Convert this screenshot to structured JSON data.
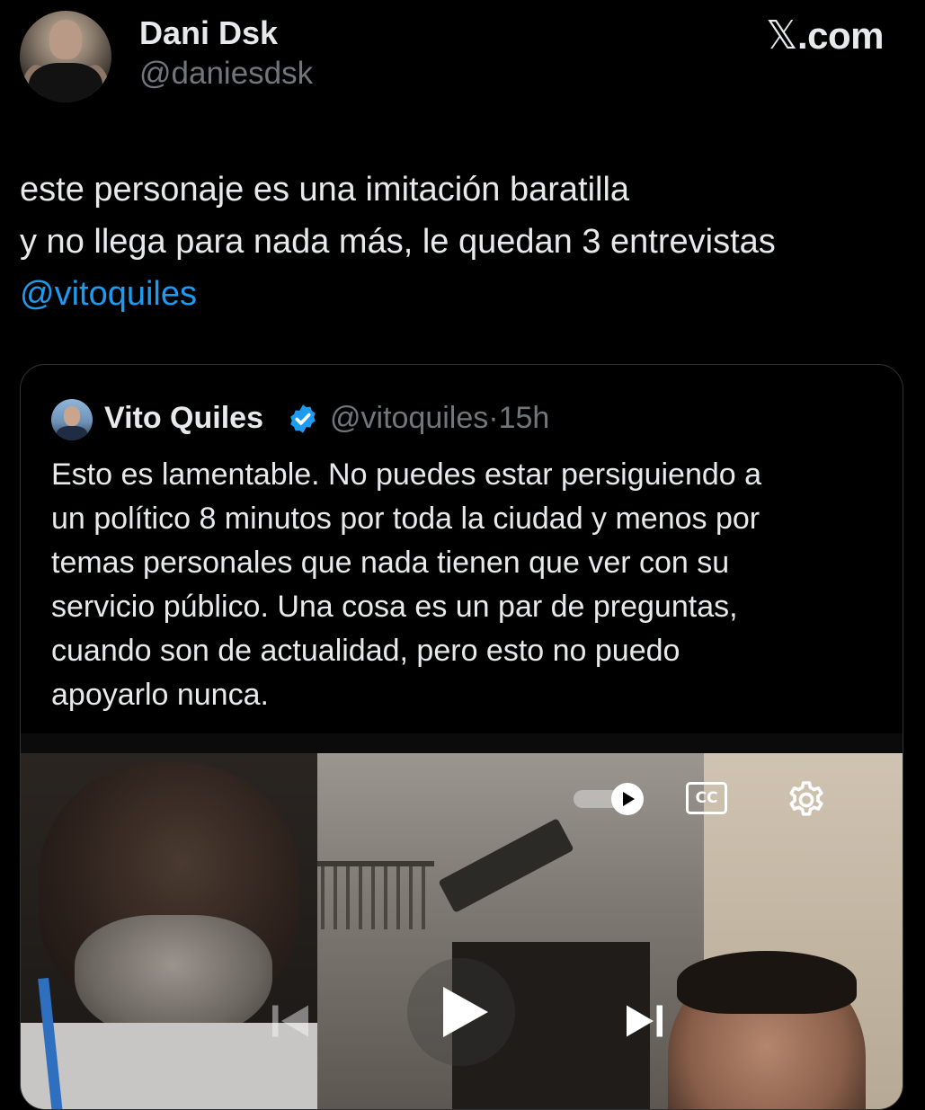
{
  "author": {
    "display_name": "Dani Dsk",
    "handle": "@daniesdsk"
  },
  "site": {
    "logo_mark": "𝕏",
    "logo_text": ".com"
  },
  "tweet": {
    "lines": [
      "este personaje es una imitación baratilla",
      "y no llega para nada más, le quedan 3 entrevistas"
    ],
    "mention": "@vitoquiles"
  },
  "quoted_tweet": {
    "display_name": "Vito Quiles",
    "verified": true,
    "handle": "@vitoquiles",
    "separator": "·",
    "time": "15h",
    "lines": [
      "Esto es lamentable. No puedes estar  persiguiendo a",
      "un político 8 minutos por toda la ciudad y menos por",
      "temas personales que nada tienen que ver con su",
      "servicio público. Una cosa es un par de preguntas,",
      "cuando son de actualidad, pero esto no puedo",
      "apoyarlo nunca."
    ]
  },
  "video_controls": {
    "cc_label": "CC",
    "icons": [
      "autoplay-toggle-icon",
      "closed-captions-icon",
      "settings-gear-icon",
      "previous-icon",
      "play-icon",
      "next-icon"
    ]
  },
  "colors": {
    "background": "#000000",
    "text": "#e7e9ea",
    "secondary": "#71767b",
    "link": "#1d9bf0",
    "border": "#2f3336"
  }
}
